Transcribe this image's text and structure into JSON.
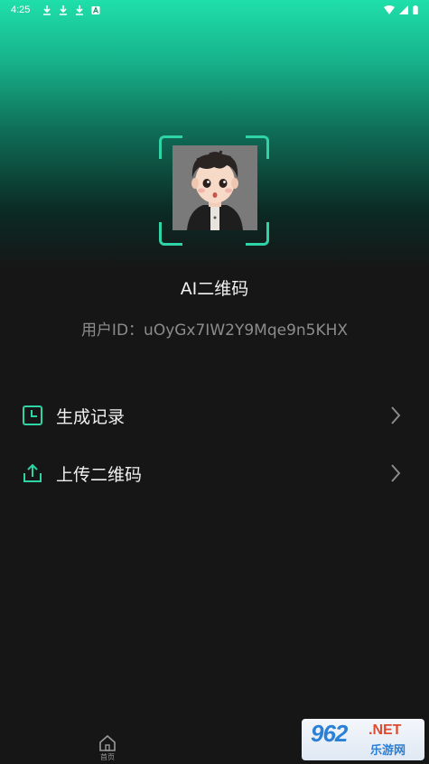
{
  "status_bar": {
    "time": "4:25",
    "left_icons": [
      "download-icon",
      "download-icon",
      "download-icon",
      "a-icon"
    ],
    "right_icons": [
      "wifi-icon",
      "signal-icon",
      "battery-icon"
    ]
  },
  "profile": {
    "avatar_icon": "cartoon-boy-avatar",
    "app_name": "AI二维码",
    "user_id_text": "用户ID：uOyGx7IW2Y9Mqe9n5KHX"
  },
  "menu": {
    "items": [
      {
        "label": "生成记录",
        "icon": "clock-icon"
      },
      {
        "label": "上传二维码",
        "icon": "upload-icon"
      }
    ]
  },
  "bottom_nav": {
    "home_label": "首页",
    "home_icon": "home-icon"
  },
  "watermark": {
    "number": "962",
    "domain": ".NET",
    "site_name": "乐游网"
  },
  "colors": {
    "accent": "#2ed3a6",
    "background": "#161616",
    "gradient_top": "#1fdfaa"
  }
}
